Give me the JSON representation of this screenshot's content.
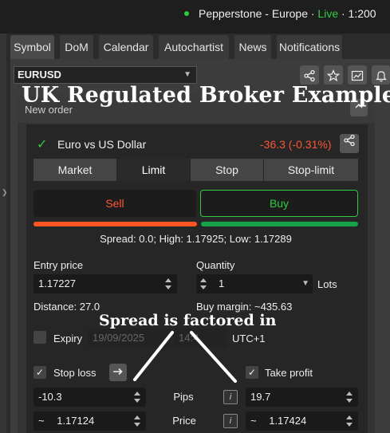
{
  "topbar": {
    "broker": "Pepperstone - Europe · ",
    "live": "Live",
    "leverage": " · 1:200"
  },
  "tabs": [
    "Symbol",
    "DoM",
    "Calendar",
    "Autochartist",
    "News",
    "Notifications"
  ],
  "symbol": {
    "value": "EURUSD"
  },
  "icons": {
    "share": "share-icon",
    "star": "star-icon",
    "chart": "chart-icon",
    "bell": "bell-icon"
  },
  "watermark": "UK Regulated Broker Example",
  "order": {
    "title": "New order",
    "instrument": "Euro vs US Dollar",
    "change": "-36.3 (-0.31%)",
    "types": [
      "Market",
      "Limit",
      "Stop",
      "Stop-limit"
    ],
    "active_type": "Limit",
    "sell_label": "Sell",
    "buy_label": "Buy",
    "spread_info": "Spread: 0.0; High: 1.17925; Low: 1.17289",
    "entry_label": "Entry price",
    "entry_value": "1.17227",
    "quantity_label": "Quantity",
    "quantity_value": "1",
    "lots_label": "Lots",
    "distance": "Distance: 27.0",
    "buy_margin": "Buy margin: ~435.63",
    "expiry_label": "Expiry",
    "expiry_date": "19/09/2025",
    "expiry_time": "14:4",
    "timezone": "UTC+1",
    "stop_loss_label": "Stop loss",
    "take_profit_label": "Take profit",
    "sl_pips": "-10.3",
    "tp_pips": "19.7",
    "pips_label": "Pips",
    "price_label": "Price",
    "sl_price": "1.17124",
    "tp_price": "1.17424",
    "approx": "~",
    "info": "i"
  },
  "annotation": "Spread is factored in",
  "colors": {
    "live": "#2ecc40",
    "sell": "#ff5533",
    "buy": "#2ecc40"
  }
}
